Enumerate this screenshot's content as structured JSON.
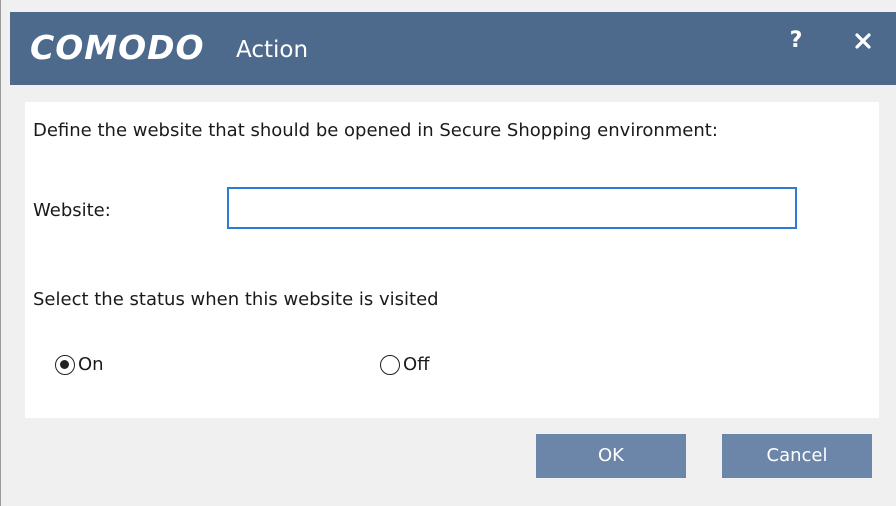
{
  "window": {
    "brand": "COMODO",
    "title": "Action",
    "help_label": "?",
    "close_icon": "close-icon"
  },
  "form": {
    "prompt": "Define the website that should be opened in Secure Shopping environment:",
    "website_label": "Website:",
    "website_value": "",
    "status_label": "Select the status when this website is visited",
    "status_options": [
      {
        "label": "On",
        "selected": true
      },
      {
        "label": "Off",
        "selected": false
      }
    ]
  },
  "buttons": {
    "ok": "OK",
    "cancel": "Cancel"
  },
  "colors": {
    "titlebar": "#4d6a8c",
    "button": "#6b86a8",
    "input_border": "#2b7bd6",
    "background": "#f0f0f0"
  }
}
